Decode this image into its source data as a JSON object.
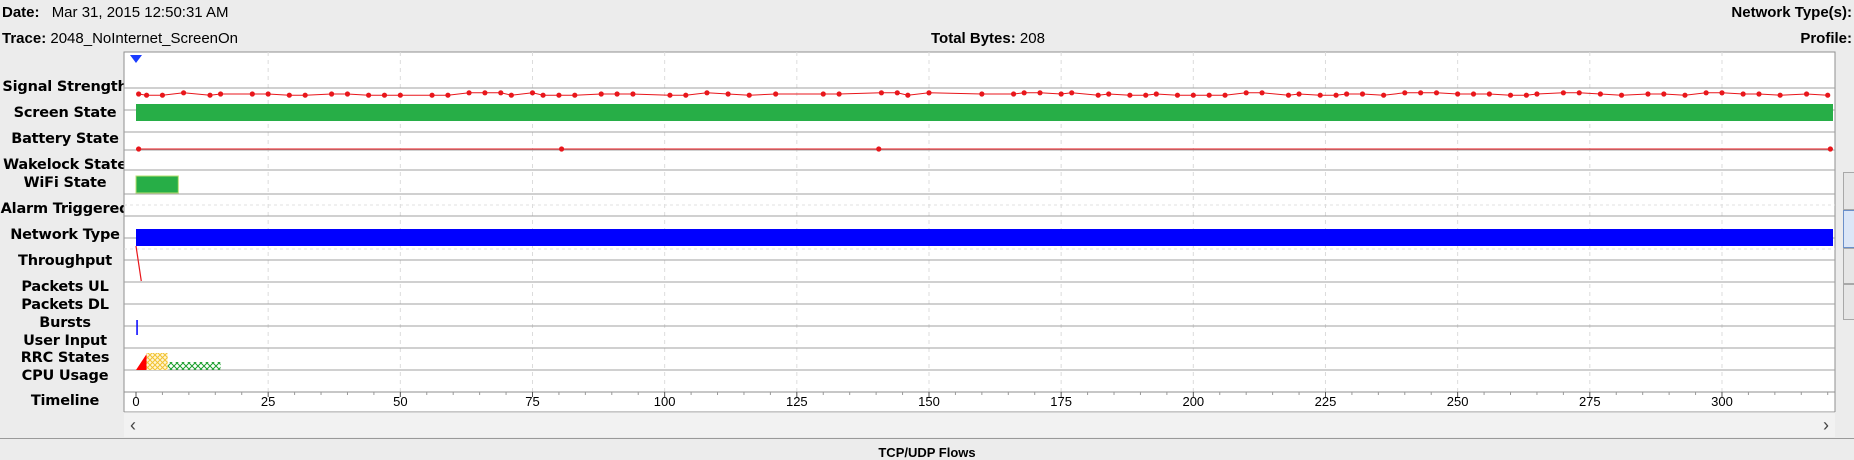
{
  "header": {
    "date_label": "Date:",
    "date_value": "Mar 31, 2015 12:50:31 AM",
    "trace_label": "Trace:",
    "trace_value": "2048_NoInternet_ScreenOn",
    "total_bytes_label": "Total Bytes:",
    "total_bytes_value": "208",
    "network_types_label": "Network Type(s):",
    "profile_label": "Profile:"
  },
  "rows": [
    "Signal Strength",
    "Screen State",
    "Battery State",
    "Wakelock State",
    "WiFi State",
    "Alarm Triggered",
    "Network Type",
    "Throughput",
    "Packets UL",
    "Packets DL",
    "Bursts",
    "User Input",
    "RRC States",
    "CPU Usage",
    "Timeline"
  ],
  "timeline": {
    "ticks": [
      "0",
      "25",
      "50",
      "75",
      "100",
      "125",
      "150",
      "175",
      "200",
      "225",
      "250",
      "275",
      "300"
    ],
    "max_seconds": 321
  },
  "colors": {
    "signal": "#e8161b",
    "screen_on": "#27ae47",
    "wifi": "#27ae47",
    "network": "#0000ff",
    "rrc_promo": "#ff0000",
    "rrc_dch": "#f1c232",
    "rrc_tail": "#1a9e2c",
    "marker": "#1a3cff"
  },
  "series": {
    "signal_strength_times": [
      0.5,
      2,
      5,
      9,
      14,
      16,
      22,
      25,
      29,
      32,
      37,
      40,
      44,
      47,
      50,
      56,
      59,
      63,
      66,
      69,
      71,
      75,
      77,
      80,
      83,
      88,
      91,
      94,
      101,
      104,
      108,
      112,
      116,
      121,
      130,
      133,
      141,
      144,
      146,
      150,
      160,
      166,
      168,
      171,
      175,
      177,
      182,
      184,
      188,
      191,
      193,
      197,
      200,
      203,
      206,
      210,
      213,
      218,
      220,
      224,
      227,
      229,
      232,
      236,
      240,
      243,
      246,
      250,
      253,
      256,
      260,
      263,
      265,
      270,
      273,
      277,
      281,
      286,
      289,
      293,
      297,
      300,
      304,
      307,
      311,
      316,
      320
    ],
    "battery_times": [
      0.5,
      80.5,
      140.5,
      320.5
    ],
    "wifi_on_range": [
      0,
      8
    ],
    "rrc_segments": [
      {
        "state": "promo",
        "from": 0,
        "to": 2
      },
      {
        "state": "dch",
        "from": 2,
        "to": 6
      },
      {
        "state": "tail",
        "from": 6,
        "to": 16
      }
    ]
  },
  "scrollbar": {
    "left_arrow": "‹",
    "right_arrow": "›"
  },
  "bottom_tab": "TCP/UDP Flows"
}
